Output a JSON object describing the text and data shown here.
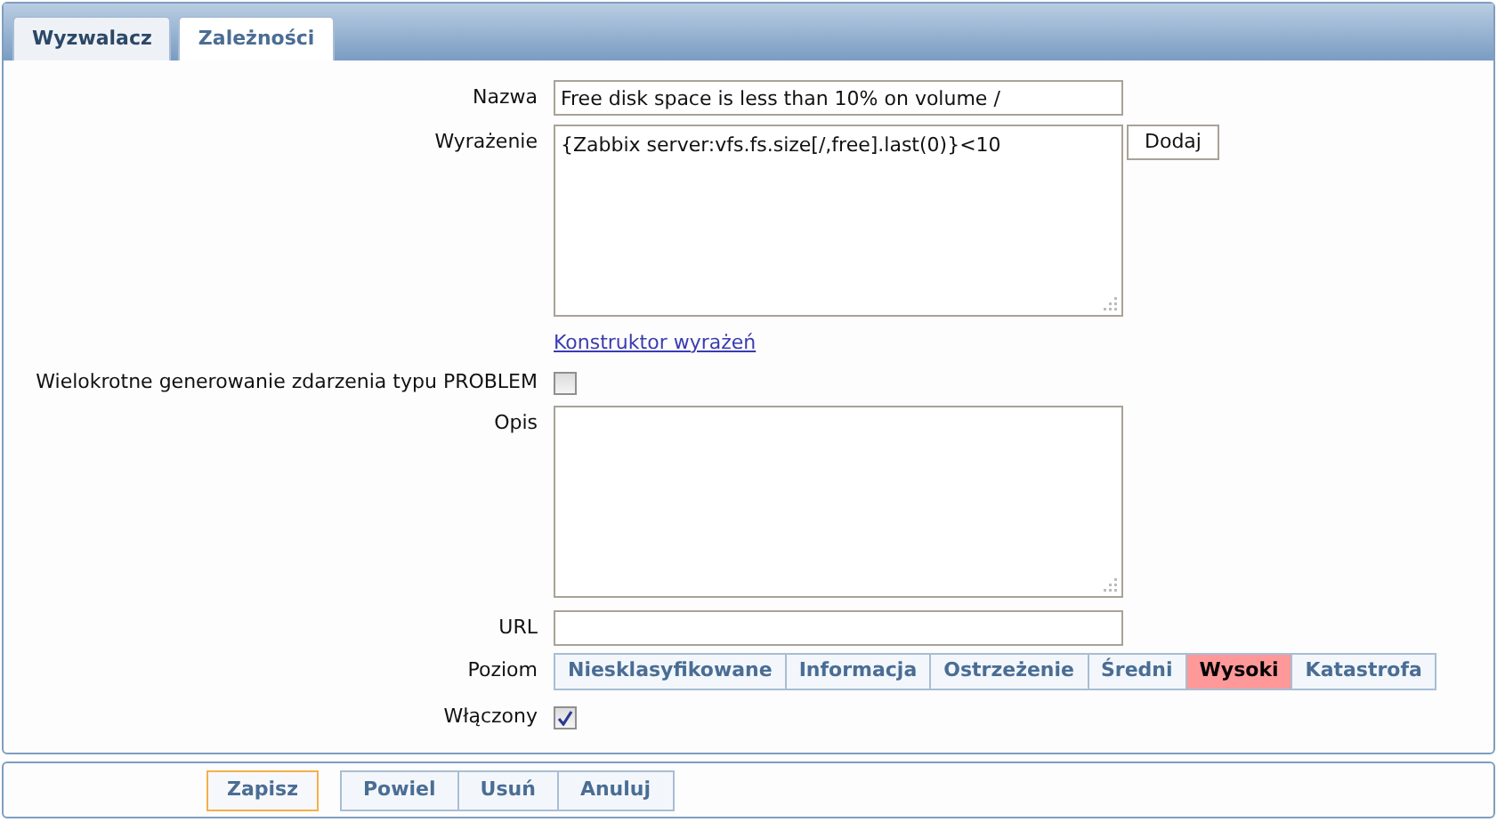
{
  "tabs": [
    {
      "label": "Wyzwalacz",
      "selected": true
    },
    {
      "label": "Zależności",
      "selected": false
    }
  ],
  "form": {
    "name": {
      "label": "Nazwa",
      "value": "Free disk space is less than 10% on volume /"
    },
    "expression": {
      "label": "Wyrażenie",
      "value": "{Zabbix server:vfs.fs.size[/,free].last(0)}<10",
      "add_button": "Dodaj",
      "builder_link": "Konstruktor wyrażeń"
    },
    "multiple_events": {
      "label": "Wielokrotne generowanie zdarzenia typu PROBLEM",
      "checked": false
    },
    "description": {
      "label": "Opis"
    },
    "url": {
      "label": "URL"
    },
    "severity": {
      "label": "Poziom",
      "options": [
        {
          "label": "Niesklasyfikowane",
          "selected": false
        },
        {
          "label": "Informacja",
          "selected": false
        },
        {
          "label": "Ostrzeżenie",
          "selected": false
        },
        {
          "label": "Średni",
          "selected": false
        },
        {
          "label": "Wysoki",
          "selected": true
        },
        {
          "label": "Katastrofa",
          "selected": false
        }
      ]
    },
    "enabled": {
      "label": "Włączony",
      "checked": true
    }
  },
  "footer": {
    "primary": "Zapisz",
    "buttons": [
      "Powiel",
      "Usuń",
      "Anuluj"
    ]
  }
}
